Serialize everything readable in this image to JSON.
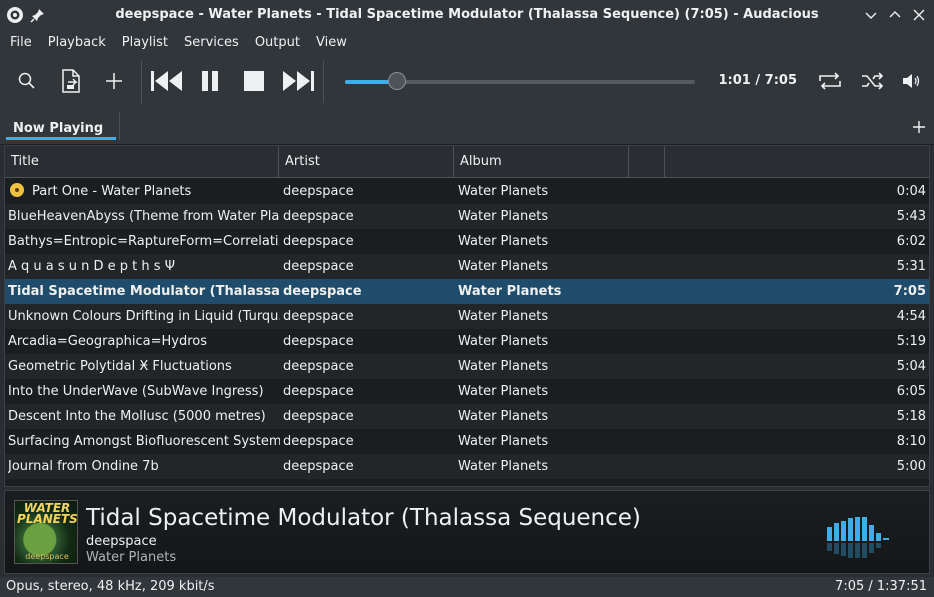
{
  "window": {
    "title": "deepspace - Water Planets - Tidal Spacetime Modulator (Thalassa Sequence) (7:05) - Audacious"
  },
  "menu": [
    "File",
    "Playback",
    "Playlist",
    "Services",
    "Output",
    "View"
  ],
  "toolbar": {
    "time": "1:01 / 7:05",
    "progress": 0.144
  },
  "tabs": [
    {
      "label": "Now Playing"
    }
  ],
  "playlist": {
    "columns": [
      "Title",
      "Artist",
      "Album"
    ],
    "rows": [
      {
        "title": "Part One - Water Planets",
        "artist": "deepspace",
        "album": "Water Planets",
        "length": "0:04"
      },
      {
        "title": "BlueHeavenAbyss (Theme from Water Pla...",
        "artist": "deepspace",
        "album": "Water Planets",
        "length": "5:43"
      },
      {
        "title": "Bathys=Entropic=RaptureForm=Correlati...",
        "artist": "deepspace",
        "album": "Water Planets",
        "length": "6:02"
      },
      {
        "title": "A q u a s u n   D e p t h s  Ψ",
        "artist": "deepspace",
        "album": "Water Planets",
        "length": "5:31"
      },
      {
        "title": "Tidal Spacetime Modulator (Thalassa S...",
        "artist": "deepspace",
        "album": "Water Planets",
        "length": "7:05"
      },
      {
        "title": "Unknown Colours Drifting in Liquid (Turqu...",
        "artist": "deepspace",
        "album": "Water Planets",
        "length": "4:54"
      },
      {
        "title": "Arcadia=Geographica=Hydros",
        "artist": "deepspace",
        "album": "Water Planets",
        "length": "5:19"
      },
      {
        "title": "Geometric Polytidal Ӿ Fluctuations",
        "artist": "deepspace",
        "album": "Water Planets",
        "length": "5:04"
      },
      {
        "title": "Into the UnderWave (SubWave Ingress)",
        "artist": "deepspace",
        "album": "Water Planets",
        "length": "6:05"
      },
      {
        "title": "Descent Into the Mollusc (5000 metres)",
        "artist": "deepspace",
        "album": "Water Planets",
        "length": "5:18"
      },
      {
        "title": "Surfacing Amongst Biofluorescent Systems",
        "artist": "deepspace",
        "album": "Water Planets",
        "length": "8:10"
      },
      {
        "title": "Journal from Ondine 7b",
        "artist": "deepspace",
        "album": "Water Planets",
        "length": "5:00"
      }
    ]
  },
  "now_playing": {
    "title": "Tidal Spacetime Modulator (Thalassa Sequence)",
    "artist": "deepspace",
    "album": "Water Planets",
    "cover_title": "WATER PLANETS",
    "cover_sub": "deepspace"
  },
  "status": {
    "format": "Opus, stereo, 48 kHz, 209 kbit/s",
    "time": "7:05 / 1:37:51"
  },
  "colors": {
    "accent": "#3daee9",
    "selection": "#1e4c6a"
  }
}
